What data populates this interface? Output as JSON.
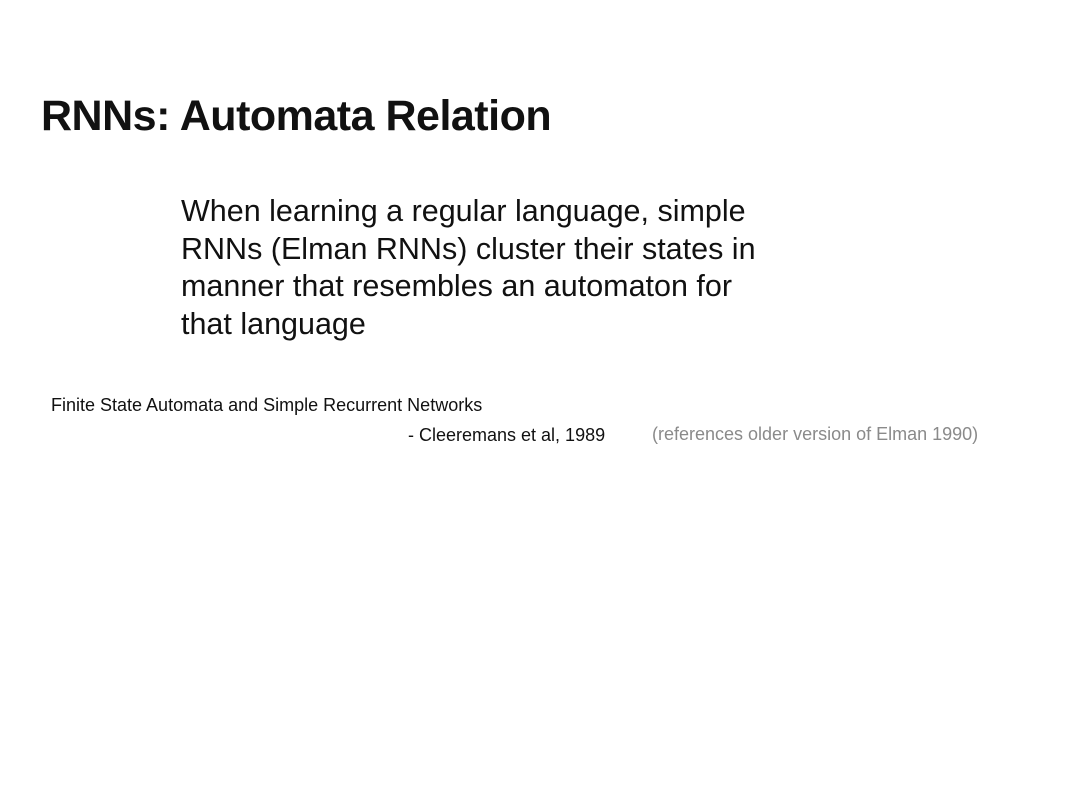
{
  "slide": {
    "title": "RNNs: Automata Relation",
    "quote_lines": [
      "When learning a regular language, simple",
      "RNNs (Elman RNNs) cluster their states in",
      "manner that resembles an automaton for",
      "that language"
    ],
    "reference": {
      "title": "Finite State Automata and Simple Recurrent Networks",
      "author": "- Cleeremans et al, 1989",
      "note": "(references older version of Elman 1990)"
    }
  },
  "colors": {
    "background": "#ffffff",
    "text": "#111111",
    "note_text": "#8a8a8a"
  }
}
